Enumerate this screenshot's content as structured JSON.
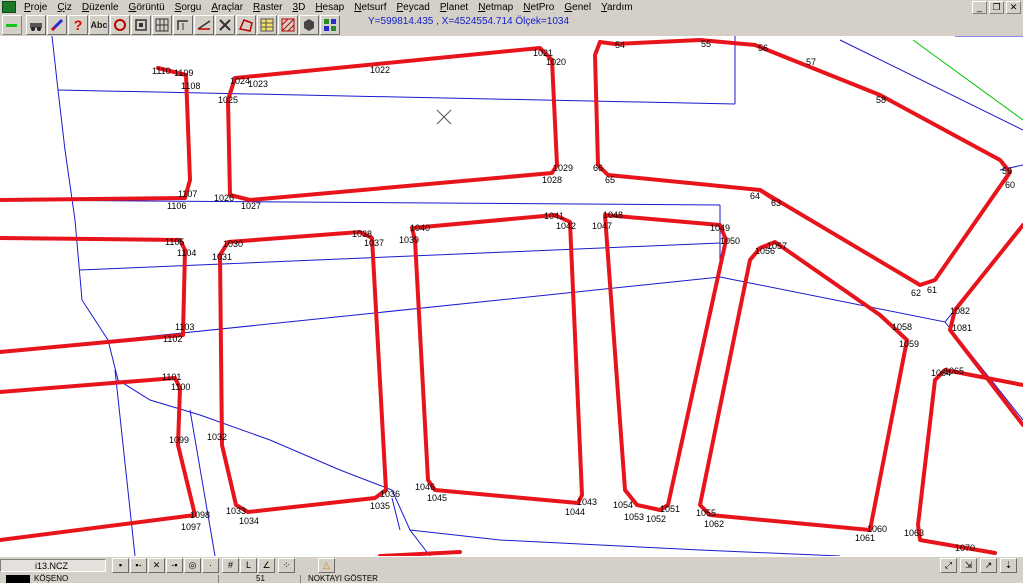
{
  "menu": {
    "items": [
      {
        "label": "Proje"
      },
      {
        "label": "Çiz"
      },
      {
        "label": "Düzenle"
      },
      {
        "label": "Görüntü"
      },
      {
        "label": "Sorgu"
      },
      {
        "label": "Araçlar"
      },
      {
        "label": "Raster"
      },
      {
        "label": "3D"
      },
      {
        "label": "Hesap"
      },
      {
        "label": "Netsurf"
      },
      {
        "label": "Peycad"
      },
      {
        "label": "Planet"
      },
      {
        "label": "Netmap"
      },
      {
        "label": "NetPro"
      },
      {
        "label": "Genel"
      },
      {
        "label": "Yardım"
      }
    ]
  },
  "window_controls": {
    "minimize": "_",
    "restore": "❐",
    "close": "✕"
  },
  "toolbar": {
    "text_tool": "Abc",
    "help": "?",
    "icons": [
      "car-icon",
      "pencil-icon",
      "help-icon",
      "text-icon",
      "circle-icon",
      "frame-icon",
      "grid-icon",
      "measure-icon",
      "cross-icon",
      "angle-icon",
      "parcel-icon",
      "table-icon",
      "hatch-icon",
      "cube-icon",
      "layers-icon"
    ]
  },
  "status": {
    "coordinates": "Y=599814.435 , X=4524554.714 Ölçek=1034"
  },
  "statusbar": {
    "file": "i13.NCZ",
    "layer": "KÖŞENO",
    "page": "51",
    "mode": "NOKTAYI GÖSTER"
  },
  "colors": {
    "parcel_line": "#e8141c",
    "base_line": "#1a1ad0",
    "green_line": "#00c000",
    "accent_text": "#1420c8"
  },
  "map": {
    "labels": [
      "1110",
      "1109",
      "1108",
      "1024",
      "1023",
      "1022",
      "1021",
      "1020",
      "55",
      "54",
      "56",
      "57",
      "58",
      "1025",
      "1029",
      "1028",
      "66",
      "65",
      "59",
      "60",
      "1107",
      "1106",
      "1026",
      "1027",
      "64",
      "63",
      "1041",
      "1042",
      "1048",
      "1047",
      "1040",
      "1039",
      "1049",
      "1050",
      "1038",
      "1037",
      "1105",
      "1104",
      "1030",
      "1031",
      "1057",
      "1056",
      "62",
      "61",
      "1082",
      "1103",
      "1102",
      "1058",
      "1081",
      "1059",
      "1101",
      "1100",
      "1064",
      "1065",
      "1099",
      "1032",
      "1046",
      "1045",
      "1036",
      "1035",
      "1043",
      "1044",
      "1054",
      "1051",
      "1053",
      "1052",
      "1055",
      "1062",
      "1098",
      "1097",
      "1033",
      "1034",
      "1060",
      "1061",
      "1063",
      "1070"
    ]
  }
}
